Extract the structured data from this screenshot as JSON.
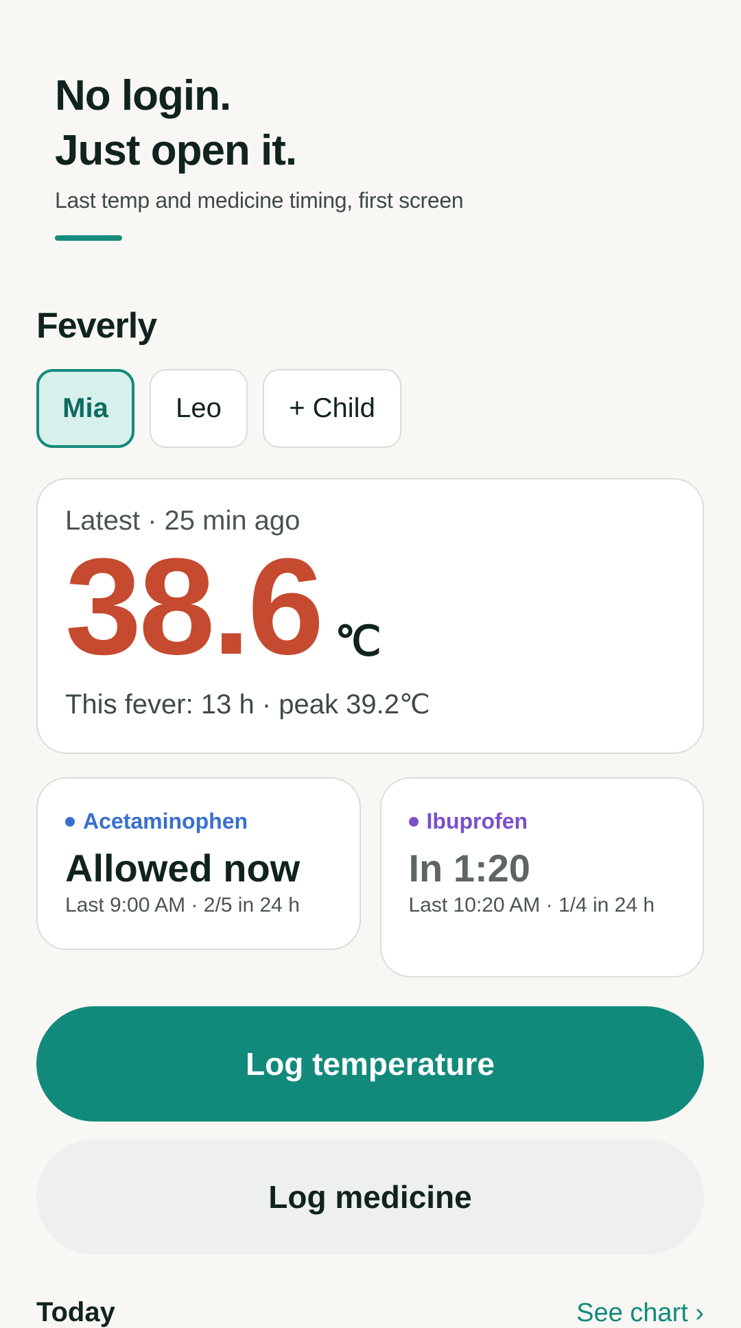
{
  "hero": {
    "title_line1": "No login.",
    "title_line2": "Just open it.",
    "subtitle": "Last temp and medicine timing, first screen"
  },
  "app": {
    "name": "Feverly"
  },
  "children": {
    "tabs": [
      {
        "label": "Mia",
        "selected": true
      },
      {
        "label": "Leo",
        "selected": false
      }
    ],
    "add_label": "+ Child"
  },
  "latest": {
    "label": "Latest · 25 min ago",
    "temperature": "38.6",
    "unit": "℃",
    "fever_info": "This fever: 13 h · peak 39.2℃"
  },
  "medicines": [
    {
      "name": "Acetaminophen",
      "color": "#3a6fcf",
      "status": "Allowed now",
      "status_color": "#10231f",
      "last": "Last 9:00 AM · 2/5 in 24 h"
    },
    {
      "name": "Ibuprofen",
      "color": "#7b4fc9",
      "status": "In 1:20",
      "status_color": "#5d6664",
      "last": "Last 10:20 AM · 1/4 in 24 h"
    }
  ],
  "actions": {
    "log_temperature": "Log temperature",
    "log_medicine": "Log medicine"
  },
  "today": {
    "label": "Today",
    "see_chart": "See chart ›"
  },
  "colors": {
    "accent": "#128a7b",
    "temperature": "#c54a2f",
    "background": "#f8f7f3"
  }
}
